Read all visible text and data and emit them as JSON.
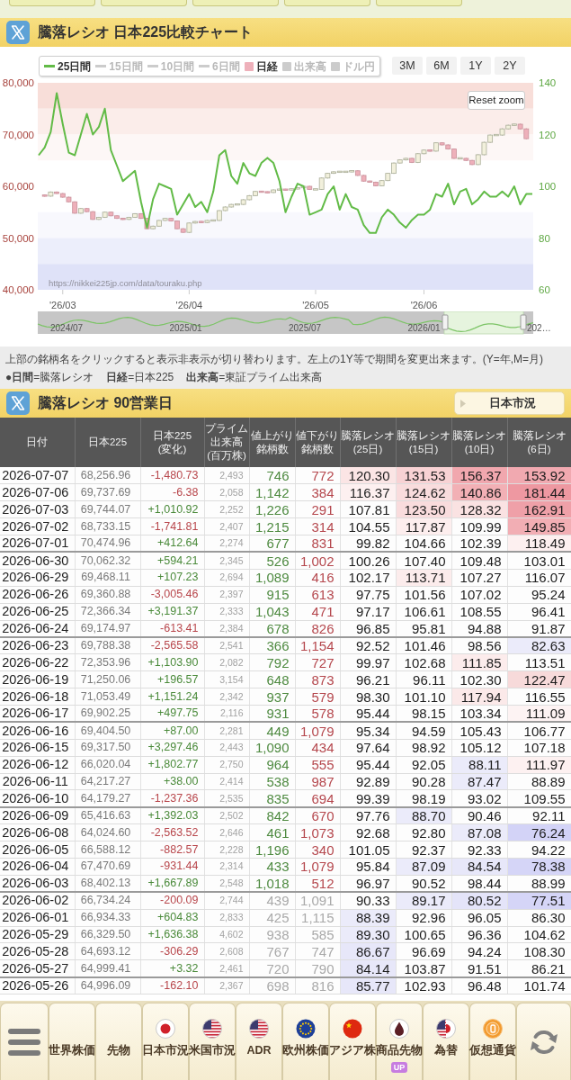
{
  "chart_header": {
    "title": "騰落レシオ 日本225比較チャート"
  },
  "chart": {
    "legend": [
      {
        "label": "25日間",
        "kind": "line",
        "selected": true,
        "color": "#62bb47"
      },
      {
        "label": "15日間",
        "kind": "line",
        "selected": false
      },
      {
        "label": "10日間",
        "kind": "line",
        "selected": false
      },
      {
        "label": "6日間",
        "kind": "line",
        "selected": false
      },
      {
        "label": "日経",
        "kind": "square",
        "selected": true,
        "color": "#eeb0ba"
      },
      {
        "label": "出来高",
        "kind": "square",
        "selected": false
      },
      {
        "label": "ドル円",
        "kind": "square",
        "selected": false
      }
    ],
    "ranges": [
      {
        "label": "3M",
        "selected": false
      },
      {
        "label": "6M",
        "selected": false
      },
      {
        "label": "1Y",
        "selected": false
      },
      {
        "label": "2Y",
        "selected": false
      }
    ],
    "reset_zoom": "Reset zoom",
    "credit": "https://nikkei225jp.com/data/touraku.php",
    "nikkei_chart": {
      "chart_data": {
        "type": "candlestick",
        "categories": [
          null,
          null,
          null,
          null,
          "'26/03",
          null,
          null,
          null,
          null,
          null,
          null,
          null,
          null,
          null,
          null,
          null,
          null,
          null,
          null,
          null,
          null,
          null,
          null,
          null,
          null,
          "'26/04",
          null,
          null,
          null,
          null,
          null,
          null,
          null,
          null,
          null,
          null,
          null,
          null,
          null,
          null,
          null,
          null,
          null,
          null,
          null,
          null,
          "'26/05",
          null,
          null,
          null,
          null,
          null,
          null,
          null,
          null,
          null,
          null,
          null,
          null,
          null,
          null,
          null,
          null,
          null,
          "'26/06",
          null,
          null,
          null,
          null,
          null,
          null,
          null,
          null,
          null,
          null,
          null,
          null,
          null,
          null,
          null,
          null,
          null,
          null
        ],
        "ylim": [
          40000,
          80000
        ],
        "yticks": [
          {
            "value": 40000,
            "label": "40,000"
          },
          {
            "value": 50000,
            "label": "50,000"
          },
          {
            "value": 60000,
            "label": "60,000"
          },
          {
            "value": 70000,
            "label": "70,000"
          },
          {
            "value": 80000,
            "label": "80,000"
          }
        ],
        "bands": [
          {
            "axis": "y",
            "from": 75000,
            "to": 80000,
            "color": "#f8ded9"
          },
          {
            "axis": "y",
            "from": 70000,
            "to": 75000,
            "color": "#fbedea"
          },
          {
            "axis": "y",
            "from": 65000,
            "to": 70000,
            "color": "#fdf7f6"
          },
          {
            "axis": "y",
            "from": 50000,
            "to": 55000,
            "color": "#f8f8fd"
          },
          {
            "axis": "y",
            "from": 45000,
            "to": 50000,
            "color": "#eceefb"
          },
          {
            "axis": "y",
            "from": 40000,
            "to": 45000,
            "color": "#dfe2f8"
          }
        ],
        "ohlc": [
          null,
          [
            58300,
            58400,
            58000,
            58100
          ],
          [
            58100,
            59000,
            58000,
            58900
          ],
          [
            58900,
            59000,
            58500,
            58600
          ],
          [
            58600,
            58700,
            57800,
            57900
          ],
          [
            57900,
            58000,
            56900,
            57000
          ],
          [
            57000,
            57100,
            54700,
            54800
          ],
          [
            54800,
            55800,
            54700,
            55700
          ],
          [
            55700,
            55800,
            55000,
            55100
          ],
          [
            55100,
            55200,
            53500,
            53600
          ],
          [
            53600,
            54100,
            53500,
            54000
          ],
          [
            54000,
            55100,
            53900,
            55000
          ],
          [
            55000,
            55100,
            54200,
            54300
          ],
          [
            54300,
            54400,
            53700,
            53800
          ],
          [
            53800,
            53900,
            53500,
            53600
          ],
          [
            53600,
            54100,
            53500,
            54000
          ],
          [
            54000,
            54800,
            53900,
            54700
          ],
          [
            54700,
            54800,
            53700,
            53800
          ],
          [
            53800,
            53900,
            51700,
            51800
          ],
          [
            51800,
            52400,
            51700,
            52300
          ],
          [
            52300,
            53500,
            52200,
            53400
          ],
          [
            53400,
            53900,
            53300,
            53800
          ],
          [
            53800,
            53900,
            53200,
            53300
          ],
          [
            53300,
            53400,
            51700,
            51800
          ],
          [
            51800,
            51900,
            51000,
            51100
          ],
          [
            51100,
            53000,
            51000,
            52900
          ],
          [
            52900,
            53300,
            52800,
            53200
          ],
          [
            53200,
            53300,
            52900,
            53000
          ],
          [
            53000,
            53500,
            52900,
            53400
          ],
          [
            53400,
            53500,
            53300,
            53400
          ],
          [
            53400,
            55400,
            53300,
            55300
          ],
          [
            55300,
            56100,
            55200,
            56000
          ],
          [
            56000,
            56600,
            55900,
            56500
          ],
          [
            56500,
            56600,
            56400,
            56500
          ],
          [
            56500,
            57500,
            56400,
            57400
          ],
          [
            57400,
            58300,
            57300,
            58200
          ],
          [
            58200,
            59100,
            58100,
            59000
          ],
          [
            59000,
            59100,
            58800,
            58900
          ],
          [
            58900,
            59000,
            58700,
            58800
          ],
          [
            58800,
            59400,
            58700,
            59300
          ],
          [
            59300,
            59500,
            59200,
            59400
          ],
          [
            59400,
            59500,
            59200,
            59300
          ],
          [
            59300,
            59600,
            59200,
            59500
          ],
          [
            59500,
            59800,
            59400,
            59700
          ],
          [
            59700,
            60100,
            59600,
            60000
          ],
          [
            60000,
            60100,
            59300,
            59400
          ],
          [
            59400,
            59500,
            59300,
            59400
          ],
          [
            59400,
            61700,
            59300,
            61600
          ],
          [
            61600,
            62600,
            61500,
            62500
          ],
          [
            62500,
            62900,
            62400,
            62800
          ],
          [
            62800,
            62900,
            62700,
            62800
          ],
          [
            62800,
            62900,
            62700,
            62800
          ],
          [
            62800,
            63100,
            62700,
            63000
          ],
          [
            63000,
            63100,
            62000,
            62100
          ],
          [
            62100,
            62200,
            60900,
            61000
          ],
          [
            61000,
            61100,
            60700,
            60800
          ],
          [
            60800,
            60900,
            60000,
            60100
          ],
          [
            60100,
            61200,
            60000,
            61100
          ],
          [
            61100,
            62600,
            61000,
            62500
          ],
          [
            62500,
            64600,
            62400,
            64500
          ],
          [
            64500,
            65200,
            64400,
            65100
          ],
          [
            65100,
            65500,
            65000,
            65400
          ],
          [
            65400,
            65500,
            64500,
            64600
          ],
          [
            64600,
            66400,
            64500,
            66300
          ],
          [
            66300,
            67100,
            66200,
            67000
          ],
          [
            67000,
            67100,
            66700,
            66800
          ],
          [
            66800,
            68500,
            66700,
            68400
          ],
          [
            68400,
            68500,
            67900,
            68000
          ],
          [
            68000,
            68100,
            67100,
            67200
          ],
          [
            67200,
            67300,
            65300,
            65400
          ],
          [
            65400,
            65500,
            65300,
            65400
          ],
          [
            65400,
            65500,
            64900,
            65000
          ],
          [
            65000,
            65100,
            64100,
            64200
          ],
          [
            64200,
            66200,
            64100,
            66100
          ],
          [
            66100,
            68600,
            66000,
            68500
          ],
          [
            68500,
            70000,
            68400,
            69900
          ],
          [
            69900,
            70000,
            69800,
            69900
          ],
          [
            69900,
            71200,
            69800,
            71100
          ],
          [
            71100,
            71900,
            71000,
            71800
          ],
          [
            71800,
            72100,
            71700,
            72000
          ],
          [
            72000,
            72100,
            71000,
            71100
          ],
          [
            71100,
            71200,
            69100,
            69200
          ],
          null
        ]
      }
    },
    "ratio_chart": {
      "chart_data": {
        "type": "line",
        "categories": [
          null,
          null,
          null,
          null,
          null,
          null,
          null,
          null,
          null,
          null,
          null,
          null,
          null,
          null,
          null,
          null,
          null,
          null,
          null,
          null,
          null,
          null,
          null,
          null,
          null,
          null,
          null,
          null,
          null,
          null,
          null,
          null,
          null,
          null,
          null,
          null,
          null,
          null,
          null,
          null,
          null,
          null,
          null,
          null,
          null,
          null,
          null,
          null,
          null,
          null,
          null,
          null,
          null,
          null,
          null,
          null,
          null,
          null,
          null,
          null,
          null,
          null,
          null,
          null,
          null,
          null,
          null,
          null,
          null,
          null,
          null,
          null,
          null,
          null,
          null,
          null,
          null,
          null,
          null,
          null,
          null,
          null,
          null
        ],
        "ylim": [
          60,
          140
        ],
        "yticks": [
          60,
          80,
          100,
          120,
          140
        ],
        "series": [
          {
            "color": "#62bb47",
            "values": [
              112,
              115,
              121,
              136,
              124,
              113,
              112,
              120,
              128,
              120,
              123,
              130,
              114,
              108,
              102,
              104,
              106,
              94,
              84,
              95,
              101,
              100,
              99,
              89,
              93,
              97,
              92,
              94,
              90,
              98,
              112,
              114,
              104,
              101,
              109,
              105,
              104,
              109,
              111,
              109,
              102,
              90,
              96,
              101,
              100,
              89,
              90,
              91,
              97,
              100,
              91,
              97,
              92,
              91,
              85,
              82,
              82,
              88,
              91,
              89,
              86,
              84,
              87,
              89,
              89,
              91,
              97,
              96,
              101,
              93,
              98,
              99,
              93,
              95,
              98,
              96,
              96,
              98,
              96,
              100,
              93,
              97,
              97
            ]
          }
        ]
      }
    },
    "navigator": {
      "labels": [
        "2024/07",
        "2025/01",
        "2025/07",
        "2026/01",
        "202…"
      ]
    }
  },
  "notes": {
    "text": "上部の銘柄名をクリックすると表示非表示が切り替わります。左上の1Y等で期間を変更出来ます。(Y=年,M=月)",
    "legend": [
      "●**日間**=騰落レシオ",
      "**日経**=日本225",
      "**出来高**=東証プライム出来高"
    ]
  },
  "table_header": {
    "title": "騰落レシオ 90営業日",
    "button": "日本市況"
  },
  "table": {
    "columns": [
      {
        "lines": [
          "日付"
        ]
      },
      {
        "lines": [
          "日本225"
        ]
      },
      {
        "lines": [
          "日本225",
          "(変化)"
        ]
      },
      {
        "lines": [
          "プライム",
          "出来高",
          "(百万株)"
        ]
      },
      {
        "lines": [
          "値上がり",
          "銘柄数"
        ]
      },
      {
        "lines": [
          "値下がり",
          "銘柄数"
        ]
      },
      {
        "lines": [
          "騰落レシオ",
          "(25日)"
        ]
      },
      {
        "lines": [
          "騰落レシオ",
          "(15日)"
        ]
      },
      {
        "lines": [
          "騰落レシオ",
          "(10日)"
        ]
      },
      {
        "lines": [
          "騰落レシオ",
          "(6日)"
        ]
      }
    ],
    "rows": [
      {
        "date": "2026-07-07",
        "nikkei": "68,256.96",
        "change": "-1,480.73",
        "rising": false,
        "volume": "2,493",
        "advances": "746",
        "declines": "772",
        "faded": false,
        "week_break": false,
        "ratios": [
          {
            "text": "120.30",
            "color": "#fbe5e5"
          },
          {
            "text": "131.53",
            "color": "#f8d2d4"
          },
          {
            "text": "156.37",
            "color": "#f1a7ae"
          },
          {
            "text": "153.92",
            "color": "#f1a9b0"
          }
        ]
      },
      {
        "date": "2026-07-06",
        "nikkei": "69,737.69",
        "change": "-6.38",
        "rising": false,
        "volume": "2,058",
        "advances": "1,142",
        "declines": "384",
        "faded": false,
        "week_break": false,
        "ratios": [
          {
            "text": "116.37",
            "color": "#fdf0f0"
          },
          {
            "text": "124.62",
            "color": "#f9dcdd"
          },
          {
            "text": "140.86",
            "color": "#f2b0b5"
          },
          {
            "text": "181.44",
            "color": "#ee98a1"
          }
        ]
      },
      {
        "date": "2026-07-03",
        "nikkei": "69,744.07",
        "change": "+1,010.92",
        "rising": true,
        "volume": "2,252",
        "advances": "1,226",
        "declines": "291",
        "faded": false,
        "week_break": false,
        "ratios": [
          {
            "text": "107.81"
          },
          {
            "text": "123.50",
            "color": "#f9dcdd"
          },
          {
            "text": "128.32",
            "color": "#fae2e2"
          },
          {
            "text": "162.91",
            "color": "#efa0a8"
          }
        ]
      },
      {
        "date": "2026-07-02",
        "nikkei": "68,733.15",
        "change": "-1,741.81",
        "rising": false,
        "volume": "2,407",
        "advances": "1,215",
        "declines": "314",
        "faded": false,
        "week_break": false,
        "ratios": [
          {
            "text": "104.55"
          },
          {
            "text": "117.87",
            "color": "#fdeeee"
          },
          {
            "text": "109.99"
          },
          {
            "text": "149.85",
            "color": "#f2aeb4"
          }
        ]
      },
      {
        "date": "2026-07-01",
        "nikkei": "70,474.96",
        "change": "+412.64",
        "rising": true,
        "volume": "2,274",
        "advances": "677",
        "declines": "831",
        "faded": false,
        "week_break": false,
        "ratios": [
          {
            "text": "99.82"
          },
          {
            "text": "104.66"
          },
          {
            "text": "102.39"
          },
          {
            "text": "118.49",
            "color": "#fdf0f0"
          }
        ]
      },
      {
        "date": "2026-06-30",
        "nikkei": "70,062.32",
        "change": "+594.21",
        "rising": true,
        "volume": "2,345",
        "advances": "526",
        "declines": "1,002",
        "faded": false,
        "week_break": true,
        "ratios": [
          {
            "text": "100.26"
          },
          {
            "text": "107.40"
          },
          {
            "text": "109.48"
          },
          {
            "text": "103.01"
          }
        ]
      },
      {
        "date": "2026-06-29",
        "nikkei": "69,468.11",
        "change": "+107.23",
        "rising": true,
        "volume": "2,694",
        "advances": "1,089",
        "declines": "416",
        "faded": false,
        "week_break": false,
        "ratios": [
          {
            "text": "102.17"
          },
          {
            "text": "113.71",
            "color": "#fcecec"
          },
          {
            "text": "107.27"
          },
          {
            "text": "116.07"
          }
        ]
      },
      {
        "date": "2026-06-26",
        "nikkei": "69,360.88",
        "change": "-3,005.46",
        "rising": false,
        "volume": "2,397",
        "advances": "915",
        "declines": "613",
        "faded": false,
        "week_break": false,
        "ratios": [
          {
            "text": "97.75"
          },
          {
            "text": "101.56"
          },
          {
            "text": "107.02"
          },
          {
            "text": "95.24"
          }
        ]
      },
      {
        "date": "2026-06-25",
        "nikkei": "72,366.34",
        "change": "+3,191.37",
        "rising": true,
        "volume": "2,333",
        "advances": "1,043",
        "declines": "471",
        "faded": false,
        "week_break": false,
        "ratios": [
          {
            "text": "97.17"
          },
          {
            "text": "106.61"
          },
          {
            "text": "108.55"
          },
          {
            "text": "96.41"
          }
        ]
      },
      {
        "date": "2026-06-24",
        "nikkei": "69,174.97",
        "change": "-613.41",
        "rising": false,
        "volume": "2,384",
        "advances": "678",
        "declines": "826",
        "faded": false,
        "week_break": false,
        "ratios": [
          {
            "text": "96.85"
          },
          {
            "text": "95.81"
          },
          {
            "text": "94.88"
          },
          {
            "text": "91.87"
          }
        ]
      },
      {
        "date": "2026-06-23",
        "nikkei": "69,788.38",
        "change": "-2,565.58",
        "rising": false,
        "volume": "2,541",
        "advances": "366",
        "declines": "1,154",
        "faded": false,
        "week_break": true,
        "ratios": [
          {
            "text": "92.52"
          },
          {
            "text": "101.46"
          },
          {
            "text": "98.56"
          },
          {
            "text": "82.63",
            "color": "#ebebfa"
          }
        ]
      },
      {
        "date": "2026-06-22",
        "nikkei": "72,353.96",
        "change": "+1,103.90",
        "rising": true,
        "volume": "2,082",
        "advances": "792",
        "declines": "727",
        "faded": false,
        "week_break": false,
        "ratios": [
          {
            "text": "99.97"
          },
          {
            "text": "102.68"
          },
          {
            "text": "111.85",
            "color": "#fcecec"
          },
          {
            "text": "113.51"
          }
        ]
      },
      {
        "date": "2026-06-19",
        "nikkei": "71,250.06",
        "change": "+196.57",
        "rising": true,
        "volume": "3,154",
        "advances": "648",
        "declines": "873",
        "faded": false,
        "week_break": false,
        "ratios": [
          {
            "text": "96.21"
          },
          {
            "text": "96.11"
          },
          {
            "text": "102.30"
          },
          {
            "text": "122.47",
            "color": "#f7dada"
          }
        ]
      },
      {
        "date": "2026-06-18",
        "nikkei": "71,053.49",
        "change": "+1,151.24",
        "rising": true,
        "volume": "2,342",
        "advances": "937",
        "declines": "579",
        "faded": false,
        "week_break": false,
        "ratios": [
          {
            "text": "98.30"
          },
          {
            "text": "101.10"
          },
          {
            "text": "117.94",
            "color": "#fbe9e9"
          },
          {
            "text": "116.55"
          }
        ]
      },
      {
        "date": "2026-06-17",
        "nikkei": "69,902.25",
        "change": "+497.75",
        "rising": true,
        "volume": "2,116",
        "advances": "931",
        "declines": "578",
        "faded": false,
        "week_break": false,
        "ratios": [
          {
            "text": "95.44"
          },
          {
            "text": "98.15"
          },
          {
            "text": "103.34"
          },
          {
            "text": "111.09",
            "color": "#fdf3f3"
          }
        ]
      },
      {
        "date": "2026-06-16",
        "nikkei": "69,404.50",
        "change": "+87.00",
        "rising": true,
        "volume": "2,281",
        "advances": "449",
        "declines": "1,079",
        "faded": false,
        "week_break": true,
        "ratios": [
          {
            "text": "95.34"
          },
          {
            "text": "94.59"
          },
          {
            "text": "105.43"
          },
          {
            "text": "106.77"
          }
        ]
      },
      {
        "date": "2026-06-15",
        "nikkei": "69,317.50",
        "change": "+3,297.46",
        "rising": true,
        "volume": "2,443",
        "advances": "1,090",
        "declines": "434",
        "faded": false,
        "week_break": false,
        "ratios": [
          {
            "text": "97.64"
          },
          {
            "text": "98.92"
          },
          {
            "text": "105.12"
          },
          {
            "text": "107.18"
          }
        ]
      },
      {
        "date": "2026-06-12",
        "nikkei": "66,020.04",
        "change": "+1,802.77",
        "rising": true,
        "volume": "2,750",
        "advances": "964",
        "declines": "555",
        "faded": false,
        "week_break": false,
        "ratios": [
          {
            "text": "95.44"
          },
          {
            "text": "92.05"
          },
          {
            "text": "88.11",
            "color": "#ebebfa"
          },
          {
            "text": "111.97",
            "color": "#fdf1f1"
          }
        ]
      },
      {
        "date": "2026-06-11",
        "nikkei": "64,217.27",
        "change": "+38.00",
        "rising": true,
        "volume": "2,414",
        "advances": "538",
        "declines": "987",
        "faded": false,
        "week_break": false,
        "ratios": [
          {
            "text": "92.89"
          },
          {
            "text": "90.28"
          },
          {
            "text": "87.47",
            "color": "#ebebfa"
          },
          {
            "text": "88.89"
          }
        ]
      },
      {
        "date": "2026-06-10",
        "nikkei": "64,179.27",
        "change": "-1,237.36",
        "rising": false,
        "volume": "2,535",
        "advances": "835",
        "declines": "694",
        "faded": false,
        "week_break": false,
        "ratios": [
          {
            "text": "99.39"
          },
          {
            "text": "98.19"
          },
          {
            "text": "93.02"
          },
          {
            "text": "109.55"
          }
        ]
      },
      {
        "date": "2026-06-09",
        "nikkei": "65,416.63",
        "change": "+1,392.03",
        "rising": true,
        "volume": "2,502",
        "advances": "842",
        "declines": "670",
        "faded": false,
        "week_break": true,
        "ratios": [
          {
            "text": "97.76"
          },
          {
            "text": "88.70",
            "color": "#ebebfa"
          },
          {
            "text": "90.46"
          },
          {
            "text": "92.11"
          }
        ]
      },
      {
        "date": "2026-06-08",
        "nikkei": "64,024.60",
        "change": "-2,563.52",
        "rising": false,
        "volume": "2,646",
        "advances": "461",
        "declines": "1,073",
        "faded": false,
        "week_break": false,
        "ratios": [
          {
            "text": "92.68"
          },
          {
            "text": "92.80"
          },
          {
            "text": "87.08",
            "color": "#ebebfa"
          },
          {
            "text": "76.24",
            "color": "#d3d3f7"
          }
        ]
      },
      {
        "date": "2026-06-05",
        "nikkei": "66,588.12",
        "change": "-882.57",
        "rising": false,
        "volume": "2,228",
        "advances": "1,196",
        "declines": "340",
        "faded": false,
        "week_break": false,
        "ratios": [
          {
            "text": "101.05"
          },
          {
            "text": "92.37"
          },
          {
            "text": "92.33"
          },
          {
            "text": "94.22"
          }
        ]
      },
      {
        "date": "2026-06-04",
        "nikkei": "67,470.69",
        "change": "-931.44",
        "rising": false,
        "volume": "2,314",
        "advances": "433",
        "declines": "1,079",
        "faded": false,
        "week_break": false,
        "ratios": [
          {
            "text": "95.84"
          },
          {
            "text": "87.09",
            "color": "#ebebfa"
          },
          {
            "text": "84.54",
            "color": "#e7e7f9"
          },
          {
            "text": "78.38",
            "color": "#d5d5f7"
          }
        ]
      },
      {
        "date": "2026-06-03",
        "nikkei": "68,402.13",
        "change": "+1,667.89",
        "rising": true,
        "volume": "2,548",
        "advances": "1,018",
        "declines": "512",
        "faded": false,
        "week_break": false,
        "ratios": [
          {
            "text": "96.97"
          },
          {
            "text": "90.52"
          },
          {
            "text": "98.44"
          },
          {
            "text": "88.99"
          }
        ]
      },
      {
        "date": "2026-06-02",
        "nikkei": "66,734.24",
        "change": "-200.09",
        "rising": false,
        "volume": "2,744",
        "advances": "439",
        "declines": "1,091",
        "faded": true,
        "week_break": true,
        "ratios": [
          {
            "text": "90.33"
          },
          {
            "text": "89.17",
            "color": "#ebebfa"
          },
          {
            "text": "80.52",
            "color": "#e4e4f9"
          },
          {
            "text": "77.51",
            "color": "#d5d5f7"
          }
        ]
      },
      {
        "date": "2026-06-01",
        "nikkei": "66,934.33",
        "change": "+604.83",
        "rising": true,
        "volume": "2,833",
        "advances": "425",
        "declines": "1,115",
        "faded": true,
        "week_break": false,
        "ratios": [
          {
            "text": "88.39",
            "color": "#ebebfa"
          },
          {
            "text": "92.96"
          },
          {
            "text": "96.05"
          },
          {
            "text": "86.30"
          }
        ]
      },
      {
        "date": "2026-05-29",
        "nikkei": "66,329.50",
        "change": "+1,636.38",
        "rising": true,
        "volume": "4,602",
        "advances": "938",
        "declines": "585",
        "faded": true,
        "week_break": false,
        "ratios": [
          {
            "text": "89.30",
            "color": "#ebebfa"
          },
          {
            "text": "100.65"
          },
          {
            "text": "96.36"
          },
          {
            "text": "104.62"
          }
        ]
      },
      {
        "date": "2026-05-28",
        "nikkei": "64,693.12",
        "change": "-306.29",
        "rising": false,
        "volume": "2,608",
        "advances": "767",
        "declines": "747",
        "faded": true,
        "week_break": false,
        "ratios": [
          {
            "text": "86.67",
            "color": "#e7e7f9"
          },
          {
            "text": "96.69"
          },
          {
            "text": "94.24"
          },
          {
            "text": "108.30"
          }
        ]
      },
      {
        "date": "2026-05-27",
        "nikkei": "64,999.41",
        "change": "+3.32",
        "rising": true,
        "volume": "2,461",
        "advances": "720",
        "declines": "790",
        "faded": true,
        "week_break": false,
        "ratios": [
          {
            "text": "84.14",
            "color": "#e7e7f9"
          },
          {
            "text": "103.87"
          },
          {
            "text": "91.51"
          },
          {
            "text": "86.21"
          }
        ]
      },
      {
        "date": "2026-05-26",
        "nikkei": "64,996.09",
        "change": "-162.10",
        "rising": false,
        "volume": "2,367",
        "advances": "698",
        "declines": "816",
        "faded": true,
        "week_break": true,
        "ratios": [
          {
            "text": "85.77",
            "color": "#e7e7f9"
          },
          {
            "text": "102.93"
          },
          {
            "text": "96.48"
          },
          {
            "text": "101.74"
          }
        ]
      }
    ]
  },
  "bottom_nav": [
    {
      "kind": "menu"
    },
    {
      "kind": "plain",
      "label": "世界株価"
    },
    {
      "kind": "plain",
      "label": "先物"
    },
    {
      "kind": "japan",
      "label": "日本市況"
    },
    {
      "kind": "usa",
      "label": "米国市況"
    },
    {
      "kind": "usa",
      "label": "ADR"
    },
    {
      "kind": "europe",
      "label": "欧州株価"
    },
    {
      "kind": "china",
      "label": "アジア株"
    },
    {
      "kind": "commodity",
      "label": "商品先物",
      "badge": "UP"
    },
    {
      "kind": "forex",
      "label": "為替"
    },
    {
      "kind": "crypto",
      "label": "仮想通貨"
    },
    {
      "kind": "refresh"
    }
  ]
}
